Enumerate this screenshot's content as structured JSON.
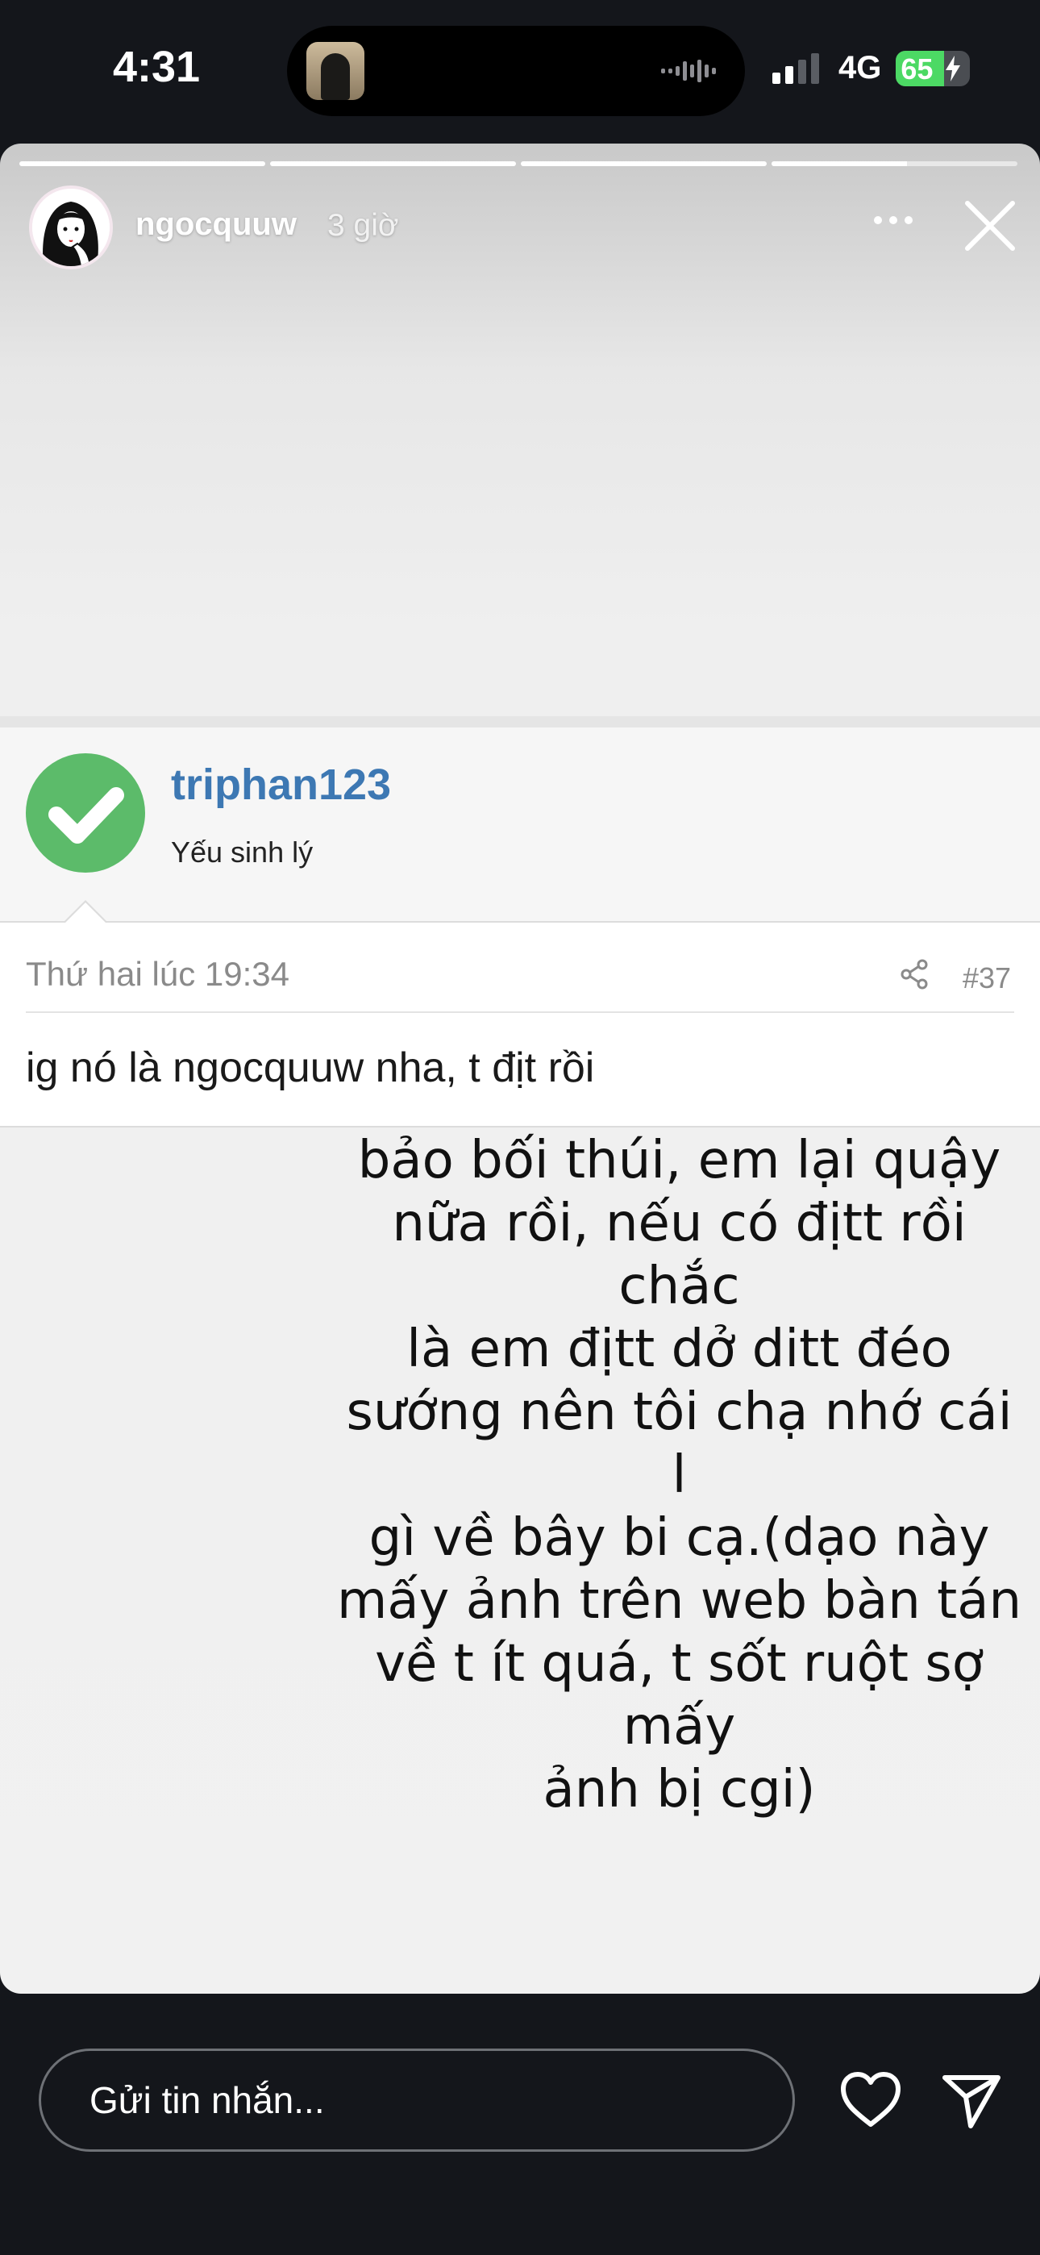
{
  "status_bar": {
    "time": "4:31",
    "network": "4G",
    "battery_percent": "65",
    "battery_level": 0.65,
    "signal_bars_active": 2,
    "signal_bars_total": 4
  },
  "story": {
    "progress_segments": [
      1,
      1,
      1,
      0.55
    ],
    "username": "ngocquuw",
    "time_ago": "3 giờ",
    "more_icon": "more-horizontal-icon",
    "close_icon": "close-icon"
  },
  "forum": {
    "author": "triphan123",
    "author_title": "Yếu sinh lý",
    "post_date": "Thứ hai lúc 19:34",
    "post_number": "#37",
    "post_text": "ig nó là ngocquuw nha, t địt rồi"
  },
  "caption": "bảo bối thúi, em lại quậy\nnữa rồi, nếu có địtt rồi chắc\nlà em địtt dở ditt đéo\nsướng nên tôi chạ nhớ cái l\ngì về  bây bi cạ.(dạo này\nmấy ảnh trên web bàn tán\nvề t ít quá, t sốt ruột sợ mấy\nảnh bị cgi)",
  "reply_bar": {
    "placeholder": "Gửi tin nhắn...",
    "like_icon": "heart-icon",
    "send_icon": "send-icon"
  },
  "colors": {
    "background": "#14161b",
    "forum_link": "#3d78b3",
    "check_green": "#5cbb6a",
    "battery_green": "#4cd964"
  }
}
